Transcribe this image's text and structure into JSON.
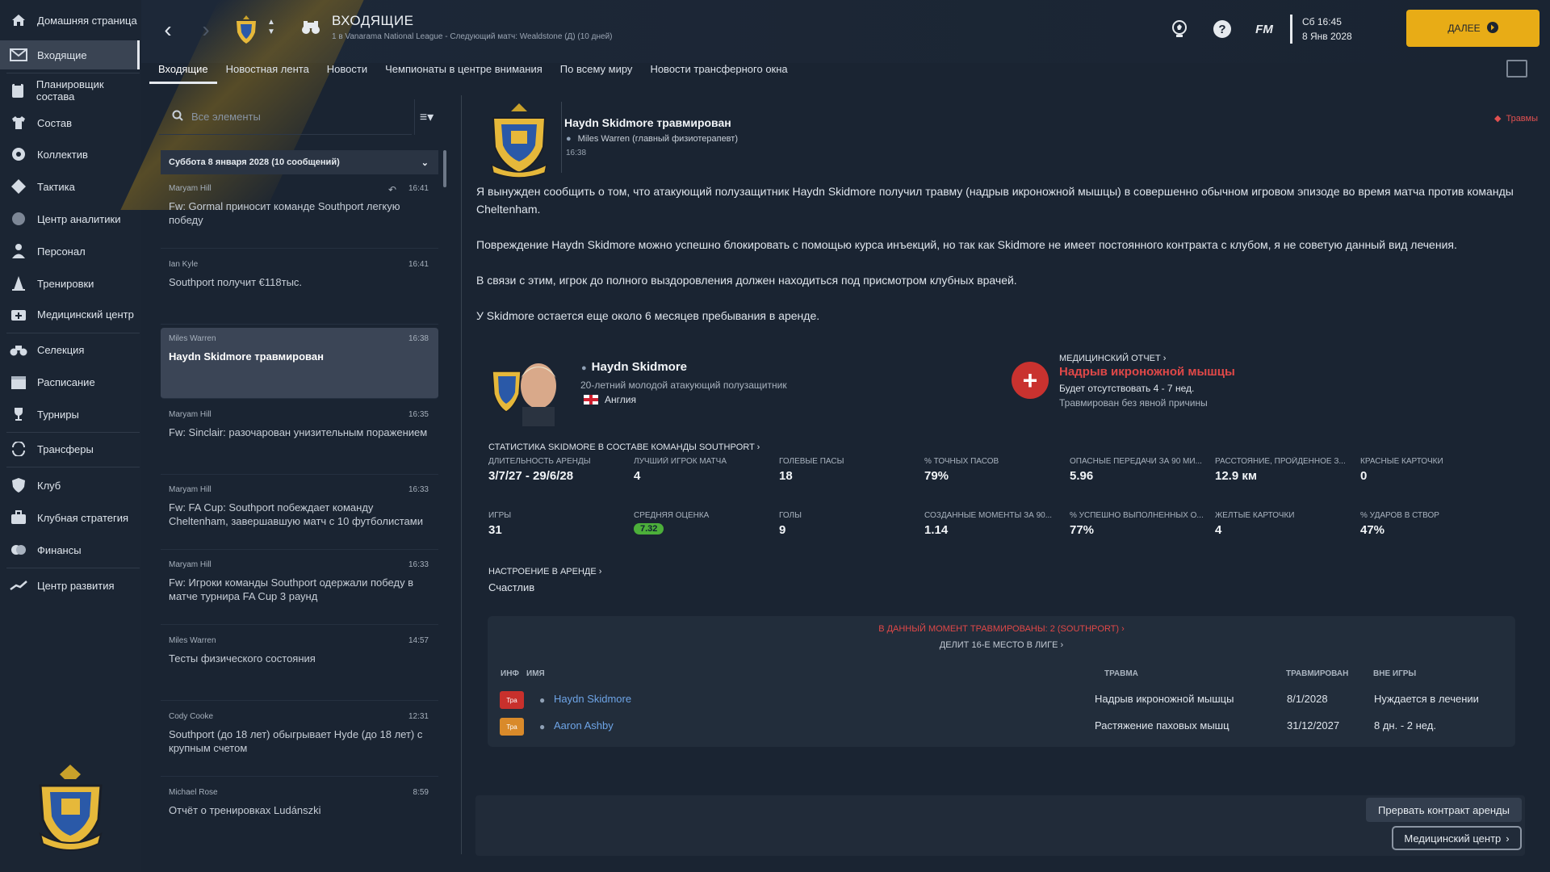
{
  "sidebar": {
    "items": [
      {
        "label": "Домашняя страница",
        "icon": "home-icon"
      },
      {
        "label": "Входящие",
        "icon": "inbox-icon"
      },
      {
        "label": "Планировщик состава",
        "icon": "squad-planner-icon"
      },
      {
        "label": "Состав",
        "icon": "shirt-icon"
      },
      {
        "label": "Коллектив",
        "icon": "dynamics-icon"
      },
      {
        "label": "Тактика",
        "icon": "tactics-icon"
      },
      {
        "label": "Центр аналитики",
        "icon": "analytics-icon"
      },
      {
        "label": "Персонал",
        "icon": "staff-icon"
      },
      {
        "label": "Тренировки",
        "icon": "training-cone-icon"
      },
      {
        "label": "Медицинский центр",
        "icon": "medical-kit-icon"
      },
      {
        "label": "Селекция",
        "icon": "binoculars-icon"
      },
      {
        "label": "Расписание",
        "icon": "calendar-icon"
      },
      {
        "label": "Турниры",
        "icon": "trophy-icon"
      },
      {
        "label": "Трансферы",
        "icon": "transfer-icon"
      },
      {
        "label": "Клуб",
        "icon": "club-shield-icon"
      },
      {
        "label": "Клубная стратегия",
        "icon": "strategy-icon"
      },
      {
        "label": "Финансы",
        "icon": "finances-icon"
      },
      {
        "label": "Центр развития",
        "icon": "development-icon"
      }
    ],
    "active_index": 1
  },
  "header": {
    "title": "ВХОДЯЩИЕ",
    "subtitle": "1 в Vanarama National League - Следующий матч: Wealdstone (Д) (10 дней)",
    "fm_label": "FM",
    "date_line1": "Сб 16:45",
    "date_line2": "8 Янв 2028",
    "next_label": "ДАЛЕЕ"
  },
  "tabs": [
    "Входящие",
    "Новостная лента",
    "Новости",
    "Чемпионаты в центре внимания",
    "По всему миру",
    "Новости трансферного окна"
  ],
  "inbox": {
    "search_placeholder": "Все элементы",
    "group_header": "Суббота 8 января 2028 (10 сообщений)",
    "messages": [
      {
        "from": "Maryam Hill",
        "time": "16:41",
        "subject": "Fw: Gormal приносит команде Southport легкую победу"
      },
      {
        "from": "Ian Kyle",
        "time": "16:41",
        "subject": "Southport получит €118тыс."
      },
      {
        "from": "Miles Warren",
        "time": "16:38",
        "subject": "Haydn Skidmore травмирован"
      },
      {
        "from": "Maryam Hill",
        "time": "16:35",
        "subject": "Fw: Sinclair: разочарован унизительным поражением"
      },
      {
        "from": "Maryam Hill",
        "time": "16:33",
        "subject": "Fw: FA Cup: Southport побеждает команду Cheltenham, завершавшую матч с 10 футболистами"
      },
      {
        "from": "Maryam Hill",
        "time": "16:33",
        "subject": "Fw: Игроки команды Southport одержали победу в матче турнира FA Cup 3 раунд"
      },
      {
        "from": "Miles Warren",
        "time": "14:57",
        "subject": "Тесты физического состояния"
      },
      {
        "from": "Cody Cooke",
        "time": "12:31",
        "subject": "Southport (до 18 лет) обыгрывает Hyde (до 18 лет) с крупным счетом"
      },
      {
        "from": "Michael Rose",
        "time": "8:59",
        "subject": "Отчёт о тренировках Ludánszki"
      }
    ]
  },
  "message": {
    "title": "Haydn Skidmore травмирован",
    "sender": "Miles Warren  (главный физиотерапевт)",
    "time": "16:38",
    "tag": "Травмы",
    "p1": "Я вынужден сообщить о том, что атакующий полузащитник Haydn Skidmore получил травму (надрыв икроножной мышцы) в совершенно обычном игровом эпизоде во время матча против команды Cheltenham.",
    "p2": "Повреждение Haydn Skidmore можно успешно блокировать с помощью курса инъекций, но так как Skidmore не имеет постоянного контракта с клубом, я не советую данный вид лечения.",
    "p3": "В связи с этим, игрок до полного выздоровления должен находиться под присмотром клубных врачей.",
    "p4": "У Skidmore остается еще около 6 месяцев пребывания в аренде."
  },
  "player": {
    "name": "Haydn Skidmore",
    "desc": "20-летний молодой атакующий полузащитник",
    "nation": "Англия",
    "medical_label": "МЕДИЦИНСКИЙ ОТЧЕТ",
    "injury": "Надрыв икроножной мышцы",
    "out": "Будет отсутствовать 4 - 7 нед.",
    "cause": "Травмирован без явной причины",
    "stats_header": "СТАТИСТИКА SKIDMORE В СОСТАВЕ КОМАНДЫ SOUTHPORT",
    "stats": [
      {
        "k": "ДЛИТЕЛЬНОСТЬ АРЕНДЫ",
        "v": "3/7/27 - 29/6/28"
      },
      {
        "k": "ЛУЧШИЙ ИГРОК МАТЧА",
        "v": "4"
      },
      {
        "k": "ГОЛЕВЫЕ ПАСЫ",
        "v": "18"
      },
      {
        "k": "% ТОЧНЫХ ПАСОВ",
        "v": "79%"
      },
      {
        "k": "ОПАСНЫЕ ПЕРЕДАЧИ ЗА 90 МИ...",
        "v": "5.96"
      },
      {
        "k": "РАССТОЯНИЕ, ПРОЙДЕННОЕ З...",
        "v": "12.9 км"
      },
      {
        "k": "КРАСНЫЕ КАРТОЧКИ",
        "v": "0"
      },
      {
        "k": "ИГРЫ",
        "v": "31"
      },
      {
        "k": "СРЕДНЯЯ ОЦЕНКА",
        "v": "7.32"
      },
      {
        "k": "ГОЛЫ",
        "v": "9"
      },
      {
        "k": "СОЗДАННЫЕ МОМЕНТЫ ЗА 90...",
        "v": "1.14"
      },
      {
        "k": "% УСПЕШНО ВЫПОЛНЕННЫХ О...",
        "v": "77%"
      },
      {
        "k": "ЖЕЛТЫЕ КАРТОЧКИ",
        "v": "4"
      },
      {
        "k": "% УДАРОВ В СТВОР",
        "v": "47%"
      }
    ],
    "mood_label": "НАСТРОЕНИЕ В АРЕНДЕ",
    "mood": "Счастлив"
  },
  "injuries": {
    "header": "В ДАННЫЙ МОМЕНТ ТРАВМИРОВАНЫ: 2 (SOUTHPORT)",
    "sub": "ДЕЛИТ 16-Е МЕСТО В ЛИГЕ",
    "cols": [
      "ИНФ",
      "ИМЯ",
      "ТРАВМА",
      "ТРАВМИРОВАН",
      "ВНЕ ИГРЫ"
    ],
    "rows": [
      {
        "badge": "Тра",
        "badge_color": "#c8302c",
        "name": "Haydn Skidmore",
        "injury": "Надрыв икроножной мышцы",
        "date": "8/1/2028",
        "out": "Нуждается в лечении"
      },
      {
        "badge": "Тра",
        "badge_color": "#d98a2a",
        "name": "Aaron Ashby",
        "injury": "Растяжение паховых мышц",
        "date": "31/12/2027",
        "out": "8 дн. - 2 нед."
      }
    ]
  },
  "actions": {
    "terminate": "Прервать контракт аренды",
    "medical": "Медицинский центр"
  }
}
